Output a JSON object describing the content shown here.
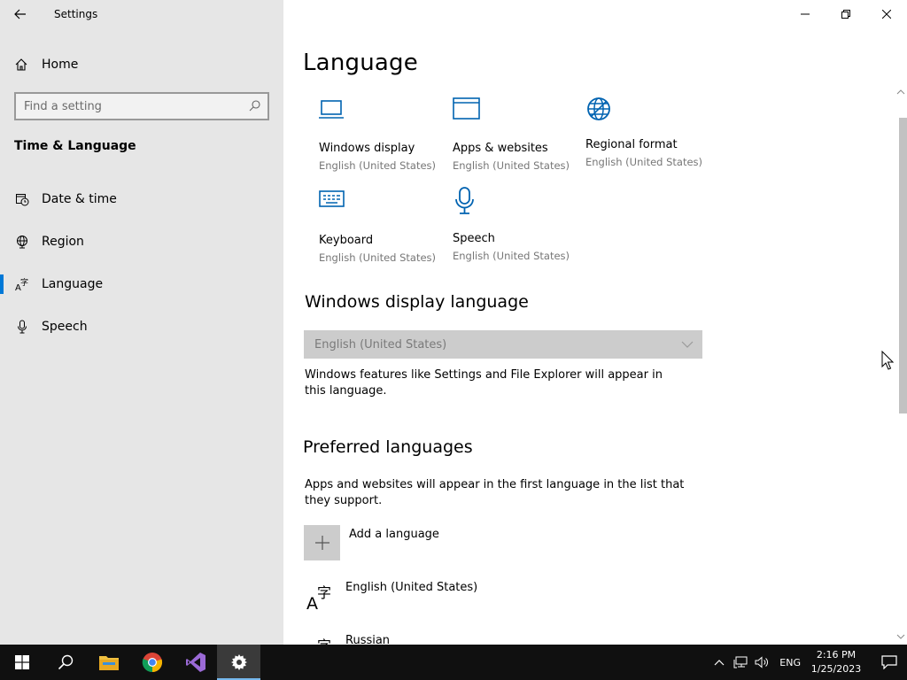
{
  "window": {
    "title": "Settings"
  },
  "sidebar": {
    "home_label": "Home",
    "search_placeholder": "Find a setting",
    "section_title": "Time & Language",
    "items": [
      {
        "label": "Date & time",
        "icon": "calendar-clock-icon"
      },
      {
        "label": "Region",
        "icon": "globe-icon"
      },
      {
        "label": "Language",
        "icon": "language-icon",
        "active": true
      },
      {
        "label": "Speech",
        "icon": "microphone-icon"
      }
    ]
  },
  "main": {
    "title": "Language",
    "tiles": [
      {
        "label": "Windows display",
        "sub": "English (United States)",
        "icon": "laptop-icon"
      },
      {
        "label": "Apps & websites",
        "sub": "English (United States)",
        "icon": "window-icon"
      },
      {
        "label": "Regional format",
        "sub": "English (United States)",
        "icon": "globe-settings-icon"
      },
      {
        "label": "Keyboard",
        "sub": "English (United States)",
        "icon": "keyboard-icon"
      },
      {
        "label": "Speech",
        "sub": "English (United States)",
        "icon": "microphone-icon"
      }
    ],
    "display_language": {
      "heading": "Windows display language",
      "selected": "English (United States)",
      "description": "Windows features like Settings and File Explorer will appear in this language."
    },
    "preferred": {
      "heading": "Preferred languages",
      "description": "Apps and websites will appear in the first language in the list that they support.",
      "add_label": "Add a language",
      "languages": [
        "English (United States)",
        "Russian"
      ]
    }
  },
  "taskbar": {
    "apps": [
      "start-icon",
      "search-icon",
      "file-explorer-icon",
      "chrome-icon",
      "visual-studio-icon",
      "settings-icon"
    ],
    "ime": "ENG",
    "time": "2:16 PM",
    "date": "1/25/2023"
  },
  "colors": {
    "accent": "#0078d7",
    "sidebar_bg": "#e6e6e6",
    "taskbar_bg": "#101010"
  }
}
